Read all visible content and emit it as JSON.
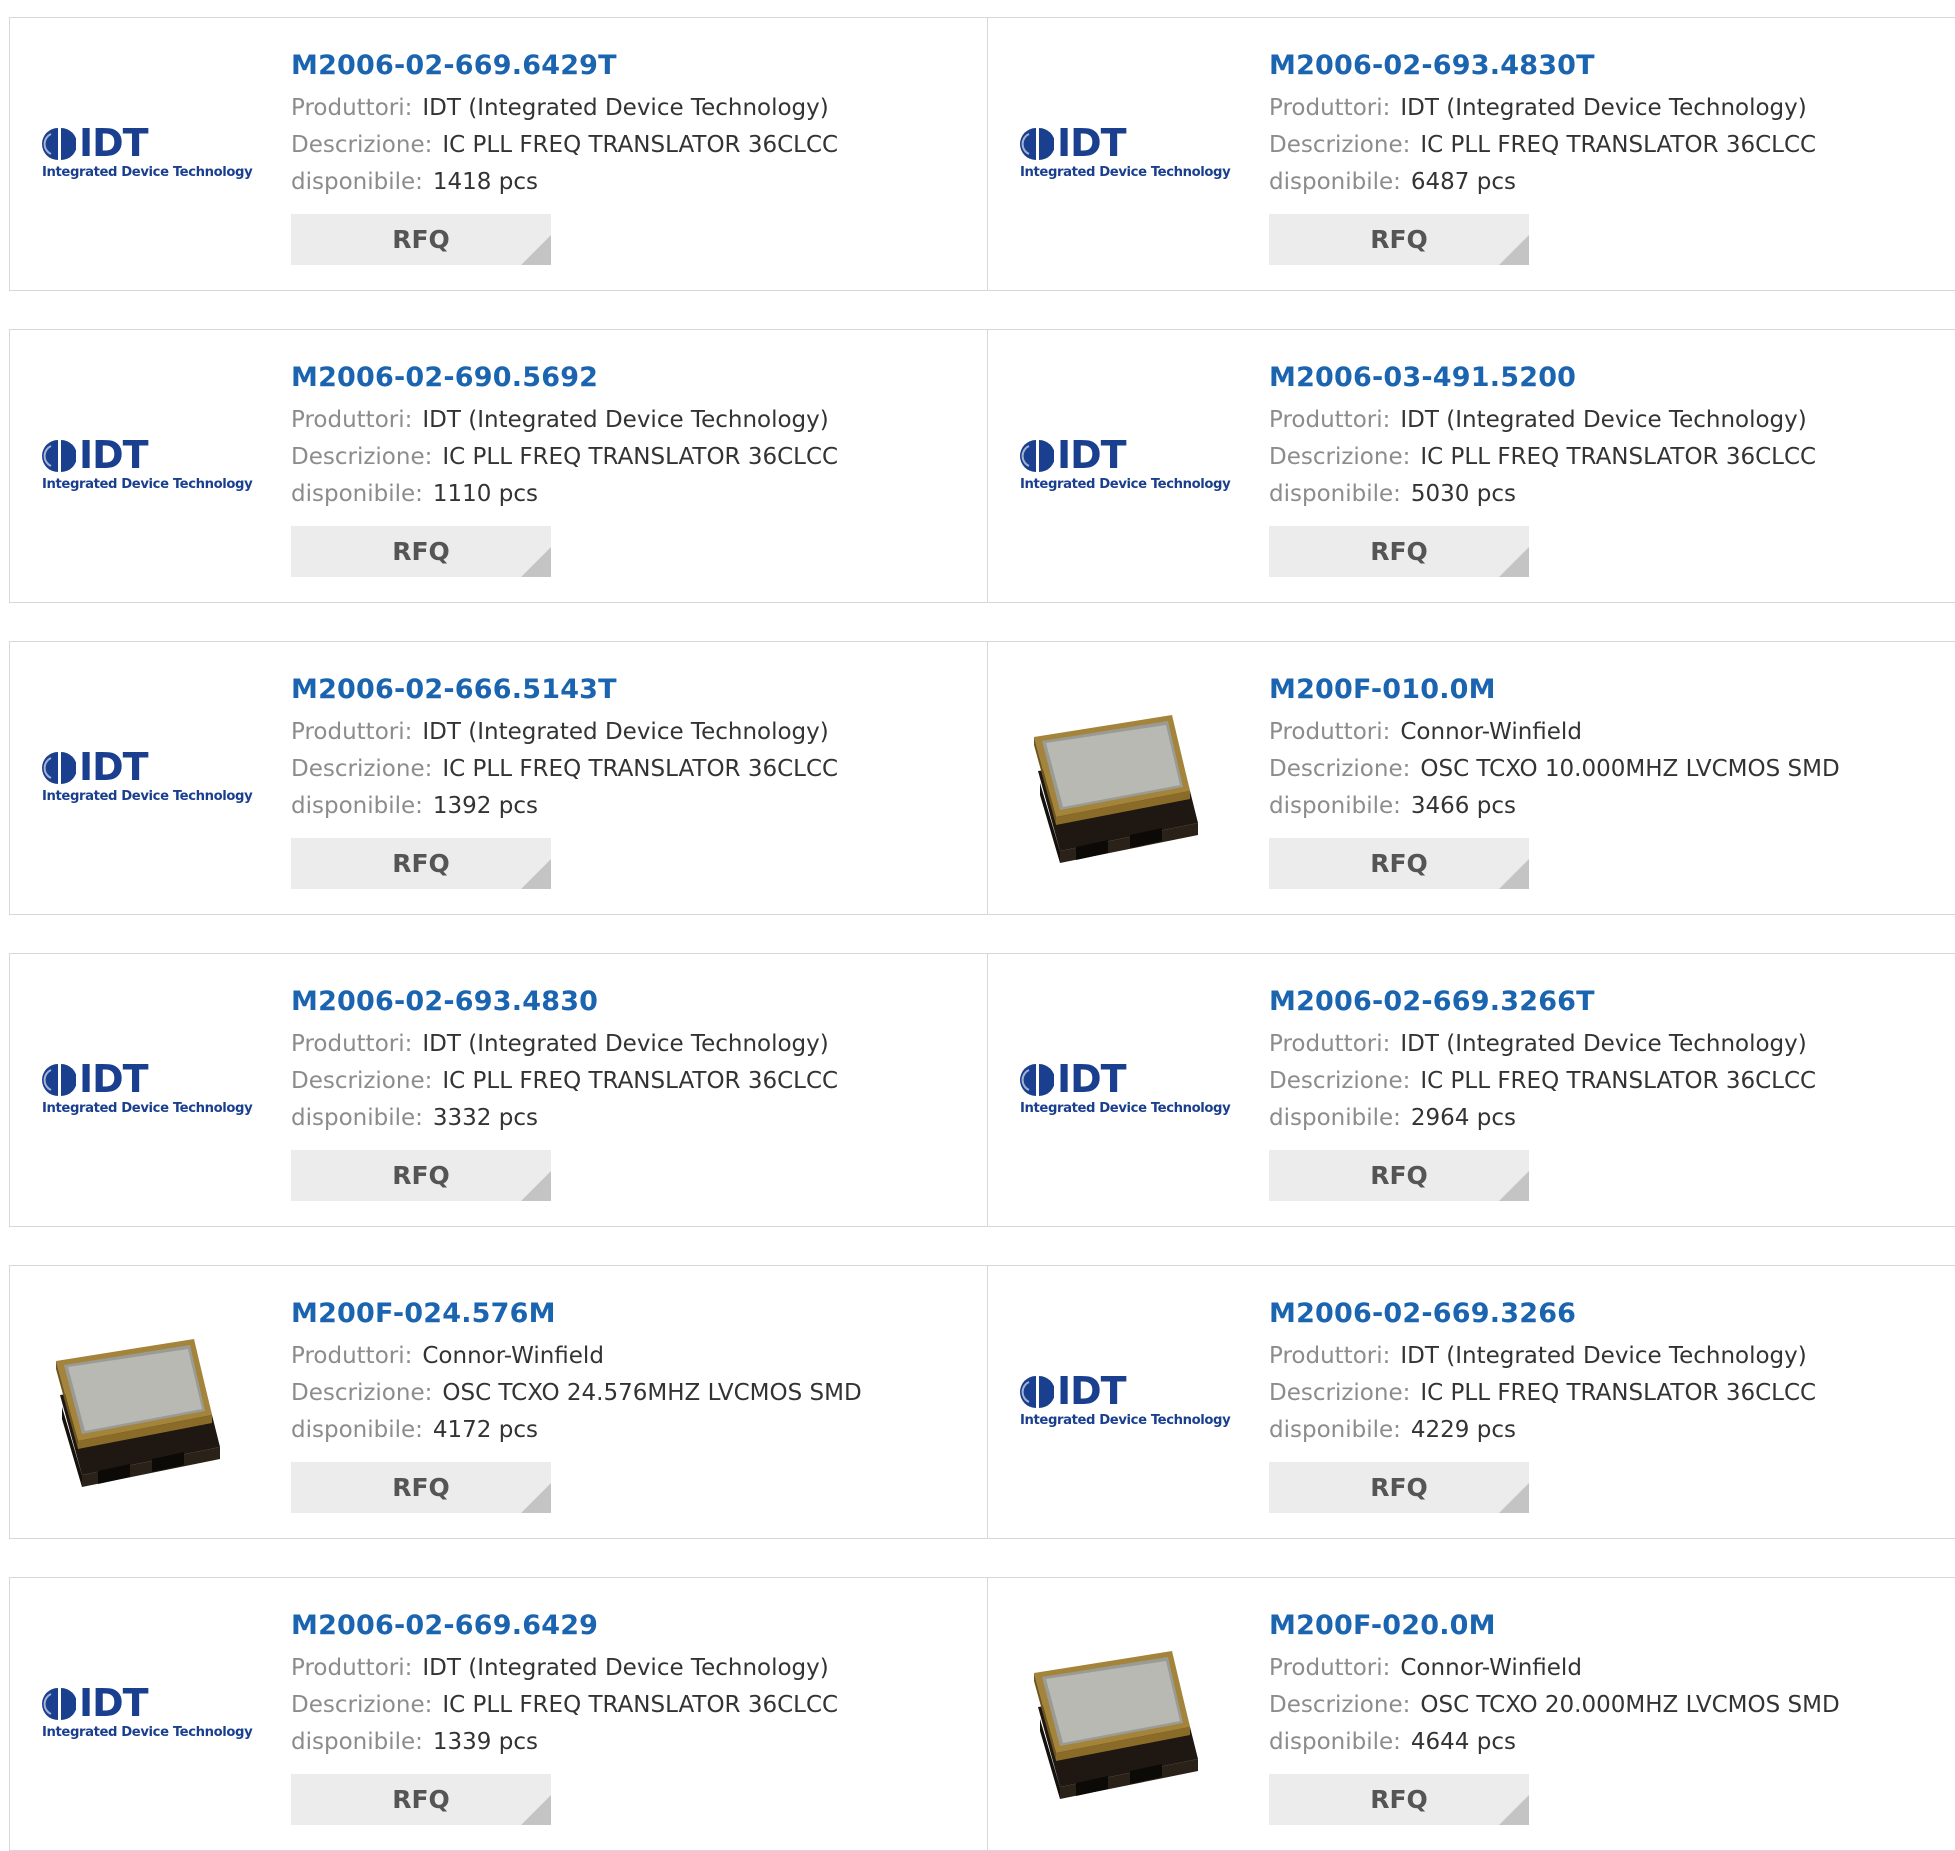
{
  "labels": {
    "manufacturer": "Produttori:",
    "description": "Descrizione:",
    "available": "disponibile:",
    "rfq": "RFQ"
  },
  "logos": {
    "idt_letters": "IDT",
    "idt_tagline": "Integrated Device Technology"
  },
  "colors": {
    "title": "#1a64b0",
    "label": "#8c8c8c",
    "value": "#333333",
    "rfq_bg": "#ececec",
    "idt_blue": "#1a3f8f"
  },
  "products": [
    {
      "part": "M2006-02-669.6429T",
      "manufacturer": "IDT (Integrated Device Technology)",
      "description": "IC PLL FREQ TRANSLATOR 36CLCC",
      "available": "1418 pcs",
      "image": "idt-logo"
    },
    {
      "part": "M2006-02-693.4830T",
      "manufacturer": "IDT (Integrated Device Technology)",
      "description": "IC PLL FREQ TRANSLATOR 36CLCC",
      "available": "6487 pcs",
      "image": "idt-logo"
    },
    {
      "part": "M2006-02-690.5692",
      "manufacturer": "IDT (Integrated Device Technology)",
      "description": "IC PLL FREQ TRANSLATOR 36CLCC",
      "available": "1110 pcs",
      "image": "idt-logo"
    },
    {
      "part": "M2006-03-491.5200",
      "manufacturer": "IDT (Integrated Device Technology)",
      "description": "IC PLL FREQ TRANSLATOR 36CLCC",
      "available": "5030 pcs",
      "image": "idt-logo"
    },
    {
      "part": "M2006-02-666.5143T",
      "manufacturer": "IDT (Integrated Device Technology)",
      "description": "IC PLL FREQ TRANSLATOR 36CLCC",
      "available": "1392 pcs",
      "image": "idt-logo"
    },
    {
      "part": "M200F-010.0M",
      "manufacturer": "Connor-Winfield",
      "description": "OSC TCXO 10.000MHZ LVCMOS SMD",
      "available": "3466 pcs",
      "image": "oscillator-chip"
    },
    {
      "part": "M2006-02-693.4830",
      "manufacturer": "IDT (Integrated Device Technology)",
      "description": "IC PLL FREQ TRANSLATOR 36CLCC",
      "available": "3332 pcs",
      "image": "idt-logo"
    },
    {
      "part": "M2006-02-669.3266T",
      "manufacturer": "IDT (Integrated Device Technology)",
      "description": "IC PLL FREQ TRANSLATOR 36CLCC",
      "available": "2964 pcs",
      "image": "idt-logo"
    },
    {
      "part": "M200F-024.576M",
      "manufacturer": "Connor-Winfield",
      "description": "OSC TCXO 24.576MHZ LVCMOS SMD",
      "available": "4172 pcs",
      "image": "oscillator-chip"
    },
    {
      "part": "M2006-02-669.3266",
      "manufacturer": "IDT (Integrated Device Technology)",
      "description": "IC PLL FREQ TRANSLATOR 36CLCC",
      "available": "4229 pcs",
      "image": "idt-logo"
    },
    {
      "part": "M2006-02-669.6429",
      "manufacturer": "IDT (Integrated Device Technology)",
      "description": "IC PLL FREQ TRANSLATOR 36CLCC",
      "available": "1339 pcs",
      "image": "idt-logo"
    },
    {
      "part": "M200F-020.0M",
      "manufacturer": "Connor-Winfield",
      "description": "OSC TCXO 20.000MHZ LVCMOS SMD",
      "available": "4644 pcs",
      "image": "oscillator-chip"
    }
  ]
}
